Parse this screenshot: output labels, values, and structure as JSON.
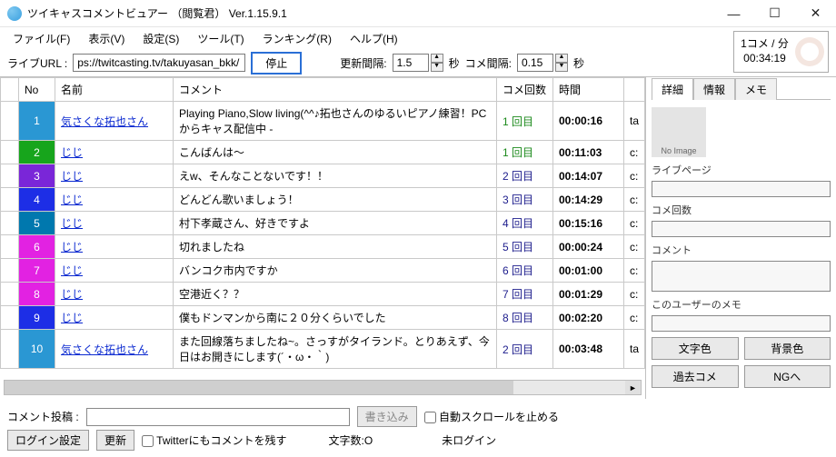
{
  "window": {
    "title": "ツイキャスコメントビュアー （閲覧君）  Ver.1.15.9.1"
  },
  "menu": [
    "ファイル(F)",
    "表示(V)",
    "設定(S)",
    "ツール(T)",
    "ランキング(R)",
    "ヘルプ(H)"
  ],
  "urlbar": {
    "label": "ライブURL :",
    "url": "ps://twitcasting.tv/takuyasan_bkk/",
    "stop": "停止",
    "interval_label": "更新間隔:",
    "interval_val": "1.5",
    "sec": "秒",
    "cm_label": "コメ間隔:",
    "cm_val": "0.15"
  },
  "stats": {
    "rate": "1コメ / 分",
    "elapsed": "00:34:19"
  },
  "columns": {
    "no": "No",
    "name": "名前",
    "comment": "コメント",
    "count": "コメ回数",
    "time": "時間"
  },
  "rows": [
    {
      "no": "1",
      "bg": "#2a97d3",
      "name": "気さくな拓也さん",
      "comment": "Playing Piano,Slow living(^^♪拓也さんのゆるいピアノ練習！PCからキャス配信中 -",
      "count": "1 回目",
      "cc": "c1",
      "time": "00:00:16",
      "ext": "ta"
    },
    {
      "no": "2",
      "bg": "#17a51c",
      "name": "じじ",
      "comment": "こんばんは～",
      "count": "1 回目",
      "cc": "c1",
      "time": "00:11:03",
      "ext": "c:"
    },
    {
      "no": "3",
      "bg": "#7a26d8",
      "name": "じじ",
      "comment": "えw、そんなことないです！！",
      "count": "2 回目",
      "cc": "ccol",
      "time": "00:14:07",
      "ext": "c:"
    },
    {
      "no": "4",
      "bg": "#1d2ee6",
      "name": "じじ",
      "comment": "どんどん歌いましょう！",
      "count": "3 回目",
      "cc": "ccol",
      "time": "00:14:29",
      "ext": "c:"
    },
    {
      "no": "5",
      "bg": "#0078ae",
      "name": "じじ",
      "comment": "村下孝蔵さん、好きですよ",
      "count": "4 回目",
      "cc": "ccol",
      "time": "00:15:16",
      "ext": "c:"
    },
    {
      "no": "6",
      "bg": "#e222e2",
      "name": "じじ",
      "comment": "切れましたね",
      "count": "5 回目",
      "cc": "ccol",
      "time": "00:00:24",
      "ext": "c:"
    },
    {
      "no": "7",
      "bg": "#e222e2",
      "name": "じじ",
      "comment": "バンコク市内ですか",
      "count": "6 回目",
      "cc": "ccol",
      "time": "00:01:00",
      "ext": "c:"
    },
    {
      "no": "8",
      "bg": "#e222e2",
      "name": "じじ",
      "comment": "空港近く？？",
      "count": "7 回目",
      "cc": "ccol",
      "time": "00:01:29",
      "ext": "c:"
    },
    {
      "no": "9",
      "bg": "#1d2ee6",
      "name": "じじ",
      "comment": "僕もドンマンから南に２０分くらいでした",
      "count": "8 回目",
      "cc": "ccol",
      "time": "00:02:20",
      "ext": "c:"
    },
    {
      "no": "10",
      "bg": "#2a97d3",
      "name": "気さくな拓也さん",
      "comment": "また回線落ちましたね~。さっすがタイランド。とりあえず、今日はお開きにします(´・ω・｀)",
      "count": "2 回目",
      "cc": "ccol",
      "time": "00:03:48",
      "ext": "ta"
    }
  ],
  "side": {
    "tabs": [
      "詳細",
      "情報",
      "メモ"
    ],
    "noimg": "No Image",
    "labels": {
      "lp": "ライブページ",
      "cnt": "コメ回数",
      "cmt": "コメント",
      "memo": "このユーザーのメモ"
    },
    "buttons": {
      "fg": "文字色",
      "bg": "背景色",
      "past": "過去コメ",
      "ng": "NGへ"
    }
  },
  "bottom": {
    "post_label": "コメント投稿 :",
    "write": "書き込み",
    "autoscroll": "自動スクロールを止める",
    "login": "ログイン設定",
    "refresh": "更新",
    "twitter": "Twitterにもコメントを残す",
    "chars": "文字数:O",
    "notlogged": "未ログイン"
  }
}
